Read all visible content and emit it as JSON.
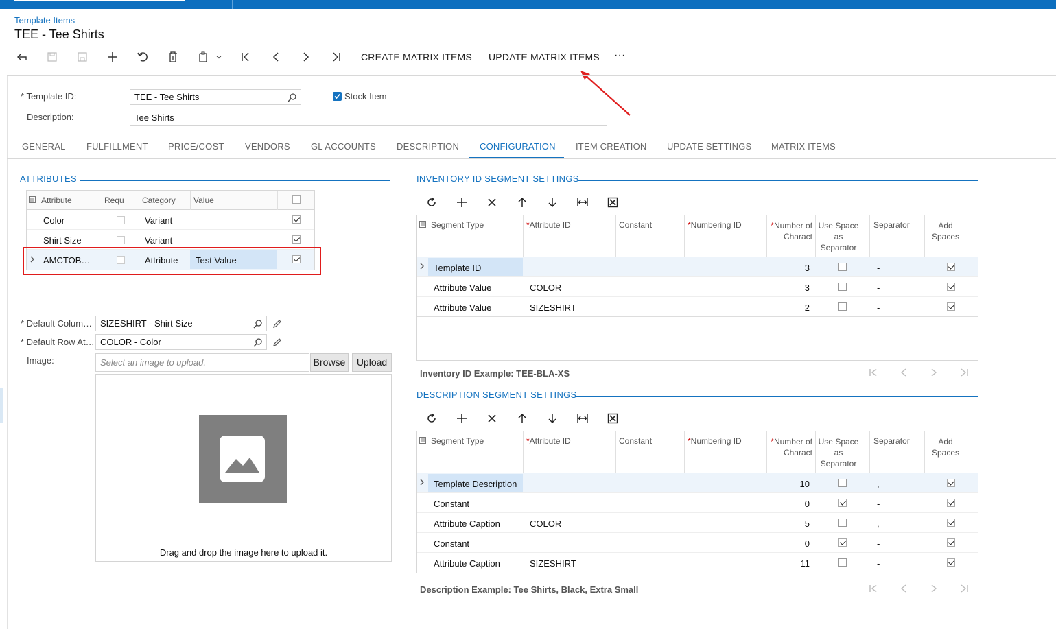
{
  "breadcrumb": "Template Items",
  "title": "TEE - Tee Shirts",
  "toolbar": {
    "icons": [
      "back-icon",
      "save-close-icon",
      "save-icon",
      "add-icon",
      "undo-icon",
      "delete-icon",
      "copy-paste-icon",
      "first-icon",
      "prev-icon",
      "next-icon",
      "last-icon"
    ],
    "create_matrix": "CREATE MATRIX ITEMS",
    "update_matrix": "UPDATE MATRIX ITEMS",
    "more": "···"
  },
  "form": {
    "template_id_label": "Template ID:",
    "template_id_value": "TEE - Tee Shirts",
    "stock_item_label": "Stock Item",
    "stock_item_checked": true,
    "description_label": "Description:",
    "description_value": "Tee Shirts"
  },
  "tabs": [
    "GENERAL",
    "FULFILLMENT",
    "PRICE/COST",
    "VENDORS",
    "GL ACCOUNTS",
    "DESCRIPTION",
    "CONFIGURATION",
    "ITEM CREATION",
    "UPDATE SETTINGS",
    "MATRIX ITEMS"
  ],
  "active_tab": "CONFIGURATION",
  "attributes": {
    "title": "ATTRIBUTES",
    "headers": [
      "Attribute",
      "Requ",
      "Category",
      "Value"
    ],
    "rows": [
      {
        "attribute": "Color",
        "required": false,
        "category": "Variant",
        "value": "",
        "selected": true
      },
      {
        "attribute": "Shirt Size",
        "required": false,
        "category": "Variant",
        "value": "",
        "selected": true
      },
      {
        "attribute": "AMCTOB…",
        "required": false,
        "category": "Attribute",
        "value": "Test Value",
        "selected": true
      }
    ]
  },
  "defaults": {
    "column_label": "Default Colum…",
    "column_value": "SIZESHIRT - Shirt Size",
    "row_label": "Default Row At…",
    "row_value": "COLOR - Color",
    "image_label": "Image:",
    "image_placeholder": "Select an image to upload.",
    "browse": "Browse",
    "upload": "Upload",
    "drop_text": "Drag and drop the image here to upload it."
  },
  "inventory_segments": {
    "title": "INVENTORY ID SEGMENT SETTINGS",
    "headers": [
      "Segment Type",
      "Attribute ID",
      "Constant",
      "Numbering ID",
      "Number of Charact",
      "Use Space as Separator",
      "Separator",
      "Add Spaces"
    ],
    "rows": [
      {
        "type": "Template ID",
        "attr": "",
        "constant": "",
        "numbering": "",
        "num": "3",
        "use_space": false,
        "sep": "-",
        "add": true
      },
      {
        "type": "Attribute Value",
        "attr": "COLOR",
        "constant": "",
        "numbering": "",
        "num": "3",
        "use_space": false,
        "sep": "-",
        "add": true
      },
      {
        "type": "Attribute Value",
        "attr": "SIZESHIRT",
        "constant": "",
        "numbering": "",
        "num": "2",
        "use_space": false,
        "sep": "-",
        "add": true
      }
    ],
    "example": "Inventory ID Example: TEE-BLA-XS"
  },
  "description_segments": {
    "title": "DESCRIPTION SEGMENT SETTINGS",
    "headers": [
      "Segment Type",
      "Attribute ID",
      "Constant",
      "Numbering ID",
      "Number of Charact",
      "Use Space as Separator",
      "Separator",
      "Add Spaces"
    ],
    "rows": [
      {
        "type": "Template Description",
        "attr": "",
        "num": "10",
        "use_space": false,
        "sep": ",",
        "add": true
      },
      {
        "type": "Constant",
        "attr": "",
        "num": "0",
        "use_space": true,
        "sep": "-",
        "add": true
      },
      {
        "type": "Attribute Caption",
        "attr": "COLOR",
        "num": "5",
        "use_space": false,
        "sep": ",",
        "add": true
      },
      {
        "type": "Constant",
        "attr": "",
        "num": "0",
        "use_space": true,
        "sep": "-",
        "add": true
      },
      {
        "type": "Attribute Caption",
        "attr": "SIZESHIRT",
        "num": "11",
        "use_space": false,
        "sep": "-",
        "add": true
      }
    ],
    "example": "Description Example: Tee Shirts, Black, Extra Small"
  }
}
